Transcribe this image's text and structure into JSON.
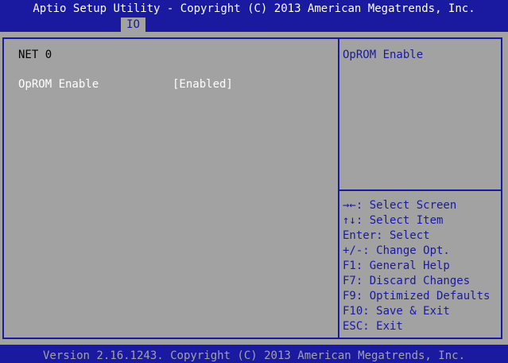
{
  "header": {
    "title": "Aptio Setup Utility - Copyright (C) 2013 American Megatrends, Inc.",
    "tabs": [
      {
        "label": "IO"
      }
    ]
  },
  "main": {
    "heading": "NET 0",
    "setting": {
      "label": "OpROM Enable",
      "value": "[Enabled]"
    }
  },
  "help_panel": {
    "description": "OpROM Enable",
    "keys": [
      "→←: Select Screen",
      "↑↓: Select Item",
      "Enter: Select",
      "+/-: Change Opt.",
      "F1: General Help",
      "F7: Discard Changes",
      "F9: Optimized Defaults",
      "F10: Save & Exit",
      "ESC: Exit"
    ]
  },
  "footer": {
    "version": "Version 2.16.1243. Copyright (C) 2013 American Megatrends, Inc."
  },
  "colors": {
    "background": "#1a1aa0",
    "panel": "#a2a2a2",
    "text": "#ffffff",
    "accent": "#1a1aa0"
  }
}
